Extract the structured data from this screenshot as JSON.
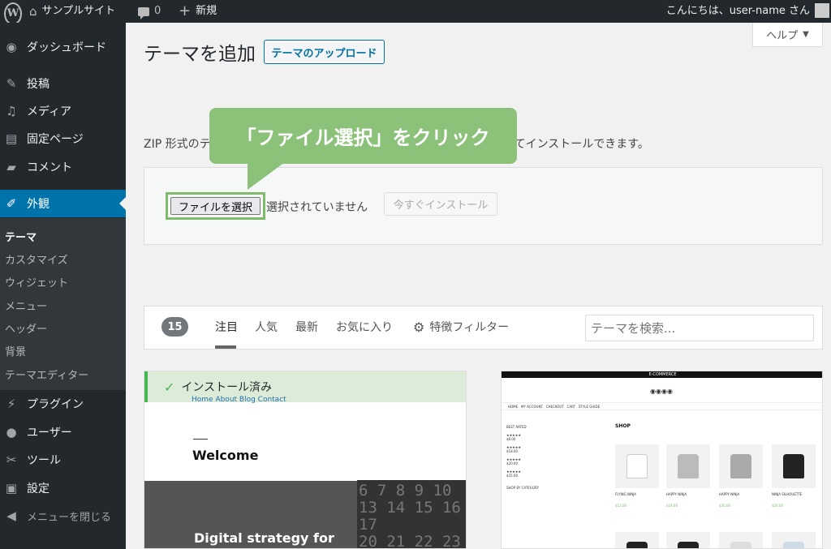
{
  "adminbar": {
    "site_name": "サンプルサイト",
    "comments_count": "0",
    "new_label": "新規",
    "greeting": "こんにちは、user-name さん"
  },
  "sidebar": {
    "items": [
      {
        "label": "ダッシュボード",
        "icon": "dashboard-icon"
      },
      {
        "label": "投稿",
        "icon": "pin-icon"
      },
      {
        "label": "メディア",
        "icon": "media-icon"
      },
      {
        "label": "固定ページ",
        "icon": "page-icon"
      },
      {
        "label": "コメント",
        "icon": "comment-icon"
      },
      {
        "label": "外観",
        "icon": "brush-icon"
      },
      {
        "label": "プラグイン",
        "icon": "plugin-icon"
      },
      {
        "label": "ユーザー",
        "icon": "user-icon"
      },
      {
        "label": "ツール",
        "icon": "wrench-icon"
      },
      {
        "label": "設定",
        "icon": "settings-icon"
      }
    ],
    "submenu": [
      "テーマ",
      "カスタマイズ",
      "ウィジェット",
      "メニュー",
      "ヘッダー",
      "背景",
      "テーマエディター"
    ],
    "collapse_label": "メニューを閉じる"
  },
  "main": {
    "title": "テーマを追加",
    "upload_button": "テーマのアップロード",
    "help_button": "ヘルプ",
    "description_start": "ZIP 形式のテ",
    "description_end": "してインストールできます。",
    "file_button": "ファイルを選択",
    "no_file_text": "選択されていません",
    "install_button": "今すぐインストール"
  },
  "callout": {
    "text": "「ファイル選択」をクリック",
    "color": "#8cc17a"
  },
  "filter": {
    "count": "15",
    "tabs": [
      "注目",
      "人気",
      "最新",
      "お気に入り"
    ],
    "feature_filter": "特徴フィルター",
    "search_placeholder": "テーマを検索..."
  },
  "theme_cards": {
    "installed_label": "インストール済み",
    "card1_nav": "Home  About  Blog  Contact",
    "card1_welcome": "Welcome",
    "card1_heading": "Digital strategy for",
    "card2_brand": "E-COMMERCE",
    "card2_shop_title": "SHOP",
    "card2_products": [
      "FLYING NINJA",
      "HAPPY NINJA",
      "HAPPY NINJA",
      "NINJA SILHOUETTE"
    ],
    "card2_prices": [
      "$12.00",
      "$18.00",
      "$35.00",
      "$20.00"
    ]
  }
}
